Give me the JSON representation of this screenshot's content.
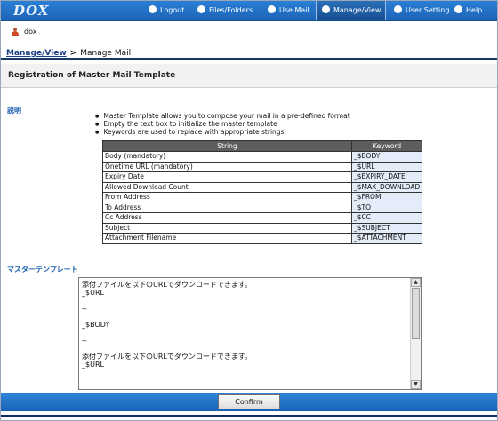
{
  "app": {
    "logo": "DOX"
  },
  "nav": [
    {
      "label": "Logout",
      "icon": "logout-icon"
    },
    {
      "label": "Files/Folders",
      "icon": "folder-icon"
    },
    {
      "label": "Use Mail",
      "icon": "mail-icon"
    },
    {
      "label": "Manage/View",
      "icon": "manage-icon",
      "active": true
    },
    {
      "label": "User Setting",
      "icon": "user-setting-icon"
    },
    {
      "label": "Help",
      "icon": "help-icon"
    }
  ],
  "user": {
    "name": "dox"
  },
  "breadcrumb": {
    "parent": "Manage/View",
    "separator": ">",
    "current": "Manage Mail"
  },
  "page": {
    "title": "Registration of Master Mail Template",
    "section_explain": "説明",
    "notes": [
      "Master Template allows you to compose your mail in a pre-defined format",
      "Empty the text box to initialize the master template",
      "Keywords are used to replace with appropriate strings"
    ],
    "table": {
      "headers": [
        "String",
        "Keyword"
      ],
      "rows": [
        [
          "Body (mandatory)",
          "_$BODY"
        ],
        [
          "Onetime URL (mandatory)",
          "_$URL"
        ],
        [
          "Expiry Date",
          "_$EXPIRY_DATE"
        ],
        [
          "Allowed Download Count",
          "_$MAX_DOWNLOAD"
        ],
        [
          "From Address",
          "_$FROM"
        ],
        [
          "To Address",
          "_$TO"
        ],
        [
          "Cc Address",
          "_$CC"
        ],
        [
          "Subject",
          "_$SUBJECT"
        ],
        [
          "Attachment Filename",
          "_$ATTACHMENT"
        ]
      ]
    },
    "section_template": "マスターテンプレート",
    "template_text": "添付ファイルを以下のURLでダウンロードできます。\n_$URL\n\n--\n\n_$BODY\n\n--\n\n添付ファイルを以下のURLでダウンロードできます。\n_$URL\n\n",
    "confirm_label": "Confirm"
  },
  "colors": {
    "nav": "#1c63b6",
    "accent": "#1d5fb4",
    "dark": "#163a63"
  }
}
